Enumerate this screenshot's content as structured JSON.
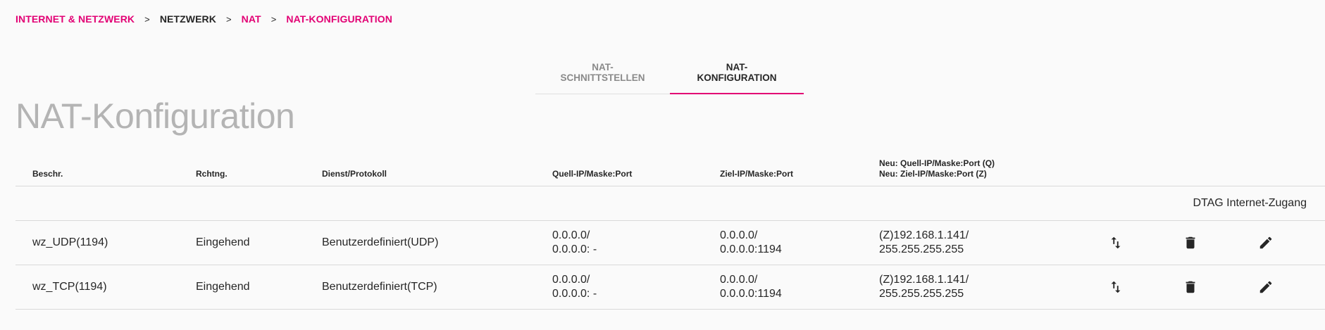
{
  "breadcrumb": {
    "items": [
      {
        "label": "INTERNET & NETZWERK",
        "link": true
      },
      {
        "label": "NETZWERK",
        "link": false
      },
      {
        "label": "NAT",
        "link": true
      },
      {
        "label": "NAT-KONFIGURATION",
        "link": true
      }
    ],
    "separator": ">"
  },
  "tabs": [
    {
      "label": "NAT-SCHNITTSTELLEN",
      "active": false
    },
    {
      "label": "NAT-KONFIGURATION",
      "active": true
    }
  ],
  "page_title": "NAT-Konfiguration",
  "table": {
    "headers": {
      "description": "Beschr.",
      "direction": "Rchtng.",
      "service": "Dienst/Protokoll",
      "source": "Quell-IP/Maske:Port",
      "destination": "Ziel-IP/Maske:Port",
      "new_line1": "Neu: Quell-IP/Maske:Port (Q)",
      "new_line2": "Neu: Ziel-IP/Maske:Port (Z)"
    },
    "group_label": "DTAG Internet-Zugang",
    "rows": [
      {
        "description": "wz_UDP(1194)",
        "direction": "Eingehend",
        "service": "Benutzerdefiniert(UDP)",
        "source_1": "0.0.0.0/",
        "source_2": "0.0.0.0: -",
        "dest_1": "0.0.0.0/",
        "dest_2": "0.0.0.0:1194",
        "new_1": "(Z)192.168.1.141/",
        "new_2": "255.255.255.255"
      },
      {
        "description": "wz_TCP(1194)",
        "direction": "Eingehend",
        "service": "Benutzerdefiniert(TCP)",
        "source_1": "0.0.0.0/",
        "source_2": "0.0.0.0: -",
        "dest_1": "0.0.0.0/",
        "dest_2": "0.0.0.0:1194",
        "new_1": "(Z)192.168.1.141/",
        "new_2": "255.255.255.255"
      }
    ],
    "row_actions": [
      "swap-icon",
      "delete-icon",
      "edit-icon"
    ]
  },
  "colors": {
    "accent": "#e20074",
    "title_gray": "#b4b4b4",
    "text": "#262626",
    "background": "#fafafa"
  }
}
